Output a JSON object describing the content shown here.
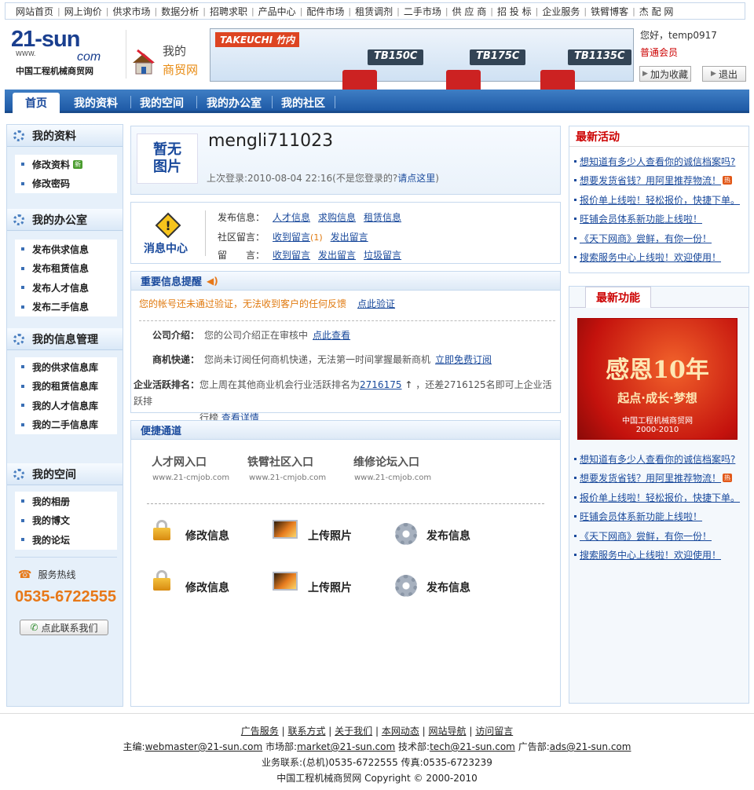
{
  "topnav": {
    "items": [
      "网站首页",
      "网上询价",
      "供求市场",
      "数据分析",
      "招聘求职",
      "产品中心",
      "配件市场",
      "租赁调剂",
      "二手市场",
      "供 应 商",
      "招 投 标",
      "企业服务",
      "铁臂博客",
      "杰 配 网"
    ]
  },
  "header": {
    "logo_main": "21-sun",
    "logo_com": "com",
    "logo_www": "WWW.",
    "logo_cn": "中国工程机械商贸网",
    "mybiz_line1": "我的",
    "mybiz_line2": "商贸网",
    "banner": {
      "brand": "TAKEUCHI 竹内",
      "models": [
        "TB150C",
        "TB175C",
        "TB1135C"
      ]
    },
    "user": {
      "greeting": "您好，temp0917",
      "level": "普通会员",
      "favorite_label": "加为收藏",
      "logout_label": "退出"
    }
  },
  "mainnav": {
    "tabs": [
      "首页",
      "我的资料",
      "我的空间",
      "我的办公室",
      "我的社区"
    ]
  },
  "sidebar": {
    "sections": [
      {
        "title": "我的资料",
        "items": [
          "修改资料",
          "修改密码"
        ],
        "new_badge": "新"
      },
      {
        "title": "我的办公室",
        "items": [
          "发布供求信息",
          "发布租赁信息",
          "发布人才信息",
          "发布二手信息"
        ]
      },
      {
        "title": "我的信息管理",
        "items": [
          "我的供求信息库",
          "我的租赁信息库",
          "我的人才信息库",
          "我的二手信息库"
        ]
      },
      {
        "title": "我的空间",
        "items": [
          "我的相册",
          "我的博文",
          "我的论坛"
        ]
      }
    ],
    "hotline_label": "服务热线",
    "hotline_number": "0535-6722555",
    "contact_button": "点此联系我们"
  },
  "profile": {
    "avatar_text_1": "暂无",
    "avatar_text_2": "图片",
    "username": "mengli711023",
    "last_login_prefix": "上次登录:2010-08-04 22:16(不是您登录的?",
    "last_login_link": "请点这里",
    "last_login_suffix": ")"
  },
  "messages": {
    "center_label": "消息中心",
    "rows": [
      {
        "label": "发布信息：",
        "links": [
          "人才信息",
          "求购信息",
          "租赁信息"
        ]
      },
      {
        "label": "社区留言：",
        "links": [
          "收到留言",
          "发出留言"
        ],
        "count": "(1)"
      },
      {
        "label": "留　　言：",
        "links": [
          "收到留言",
          "发出留言",
          "垃圾留言"
        ]
      }
    ]
  },
  "important": {
    "title": "重要信息提醒",
    "warning": "您的帐号还未通过验证，无法收到客户的任何反馈",
    "warning_link": "点此验证",
    "rows": [
      {
        "label": "公司介绍：",
        "text": "您的公司介绍正在审核中",
        "link": "点此查看"
      },
      {
        "label": "商机快递：",
        "text": "您尚未订阅任何商机快递，无法第一时间掌握最新商机",
        "link": "立即免费订阅"
      }
    ],
    "rank_label": "企业活跃排名：",
    "rank_text1": "您上周在其他商业机会行业活跃排名为",
    "rank_value": "2716175",
    "rank_arrow": "↑",
    "rank_text2": "，还差2716125名即可上企业活跃排",
    "rank_text3": "行榜",
    "rank_link": "查看详情"
  },
  "quick": {
    "title": "便捷通道",
    "entries": [
      {
        "label": "人才网入口",
        "url": "www.21-cmjob.com"
      },
      {
        "label": "铁臂社区入口",
        "url": "www.21-cmjob.com"
      },
      {
        "label": "维修论坛入口",
        "url": "www.21-cmjob.com"
      }
    ],
    "actions": [
      "修改信息",
      "上传照片",
      "发布信息",
      "修改信息",
      "上传照片",
      "发布信息"
    ]
  },
  "right": {
    "activity_title": "最新活动",
    "activity_items": [
      "想知道有多少人查看你的诚信档案吗?",
      "想要发货省钱？用阿里推荐物流！",
      "报价单上线啦！轻松报价，快捷下单。",
      "旺铺会员体系新功能上线啦！",
      "《天下网商》尝鲜，有你一份！",
      "搜索服务中心上线啦！欢迎使用！"
    ],
    "feature_title": "最新功能",
    "promo_title": "感恩10年",
    "promo_sub": "起点·成长·梦想",
    "promo_org": "中国工程机械商贸网",
    "promo_years": "2000-2010",
    "feature_items": [
      "想知道有多少人查看你的诚信档案吗?",
      "想要发货省钱？用阿里推荐物流！",
      "报价单上线啦！轻松报价，快捷下单。",
      "旺铺会员体系新功能上线啦！",
      "《天下网商》尝鲜，有你一份！",
      "搜索服务中心上线啦！欢迎使用！"
    ],
    "hot_badge": "热"
  },
  "footer": {
    "links": [
      "广告服务",
      "联系方式",
      "关于我们",
      "本网动态",
      "网站导航",
      "访问留言"
    ],
    "contacts": [
      {
        "label": "主编:",
        "email": "webmaster@21-sun.com"
      },
      {
        "label": "市场部:",
        "email": "market@21-sun.com"
      },
      {
        "label": "技术部:",
        "email": "tech@21-sun.com"
      },
      {
        "label": "广告部:",
        "email": "ads@21-sun.com"
      }
    ],
    "phone_line": "业务联系:(总机)0535-6722555 传真:0535-6723239",
    "copyright": "中国工程机械商贸网 Copyright © 2000-2010"
  }
}
